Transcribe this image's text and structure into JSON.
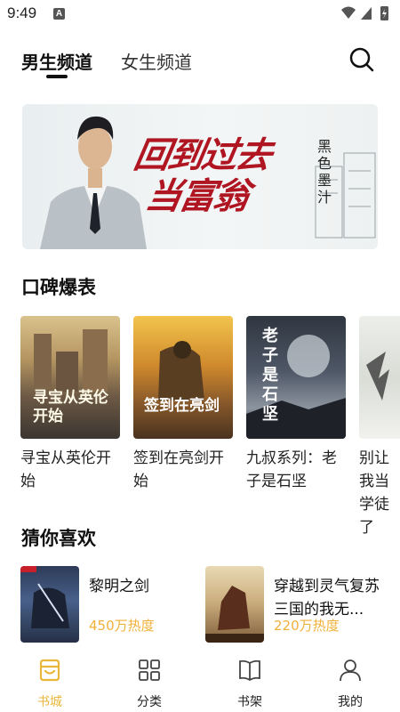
{
  "status": {
    "time": "9:49",
    "notif": "A"
  },
  "tabs": [
    {
      "label": "男生频道",
      "active": true
    },
    {
      "label": "女生频道",
      "active": false
    }
  ],
  "banner": {
    "title_line1": "回到过去",
    "title_line2": "当富翁",
    "author": "黑色墨汁"
  },
  "section_popular": {
    "title": "口碑爆表",
    "books": [
      {
        "title": "寻宝从英伦开始",
        "cover_text": "寻宝从英伦开始"
      },
      {
        "title": "签到在亮剑开始",
        "cover_text": "签到在亮剑"
      },
      {
        "title": "九叔系列：老子是石坚",
        "cover_text": "老子是石坚"
      },
      {
        "title": "别让我当学徒了"
      }
    ]
  },
  "section_guess": {
    "title": "猜你喜欢",
    "books": [
      {
        "title": "黎明之剑",
        "heat": "450万热度"
      },
      {
        "title": "穿越到灵气复苏三国的我无...",
        "heat": "220万热度"
      }
    ]
  },
  "bottom_nav": [
    {
      "label": "书城",
      "icon": "bookstore-icon",
      "active": true
    },
    {
      "label": "分类",
      "icon": "category-grid-icon",
      "active": false
    },
    {
      "label": "书架",
      "icon": "bookshelf-icon",
      "active": false
    },
    {
      "label": "我的",
      "icon": "user-icon",
      "active": false
    }
  ],
  "colors": {
    "accent": "#e8b73b",
    "heat": "#f0b13a",
    "banner_title": "#b01522"
  }
}
